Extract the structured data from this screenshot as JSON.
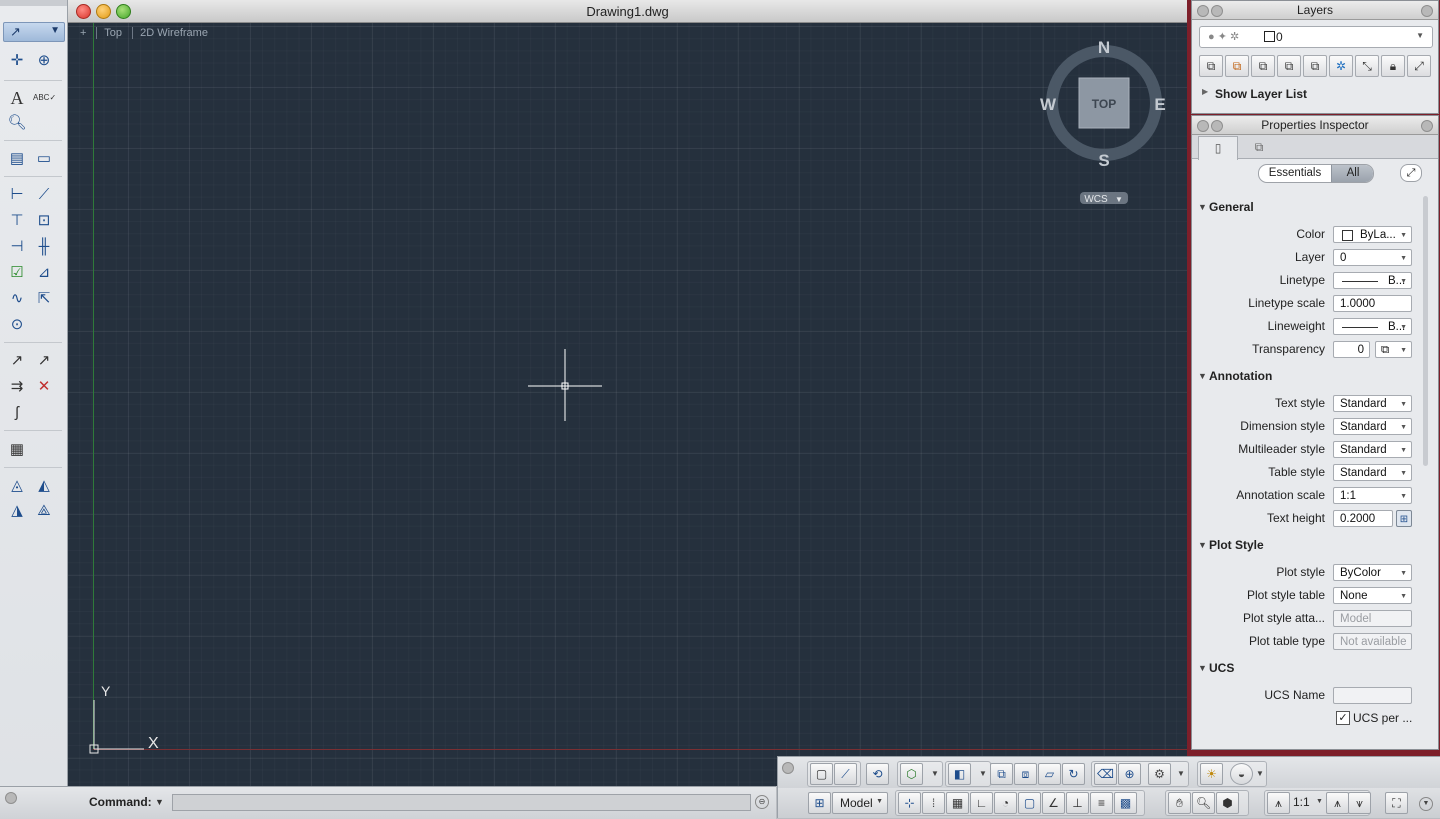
{
  "drawing": {
    "title": "Drawing1.dwg",
    "view_controls": [
      "+",
      "Top",
      "2D Wireframe"
    ],
    "viewcube": {
      "north": "N",
      "south": "S",
      "east": "E",
      "west": "W",
      "face": "TOP",
      "ucs_menu": "WCS"
    },
    "ucs_icon": {
      "x_label": "X",
      "y_label": "Y"
    }
  },
  "layers": {
    "title": "Layers",
    "current_layer": "0",
    "show_layer_list": "Show Layer List"
  },
  "properties": {
    "title": "Properties Inspector",
    "tabs": {
      "essentials": "Essentials",
      "all": "All"
    },
    "general": {
      "heading": "General",
      "color_label": "Color",
      "color_value": "ByLa...",
      "layer_label": "Layer",
      "layer_value": "0",
      "linetype_label": "Linetype",
      "linetype_value": "B...",
      "linetype_scale_label": "Linetype scale",
      "linetype_scale_value": "1.0000",
      "lineweight_label": "Lineweight",
      "lineweight_value": "B...",
      "transparency_label": "Transparency",
      "transparency_value": "0"
    },
    "annotation": {
      "heading": "Annotation",
      "text_style_label": "Text style",
      "text_style_value": "Standard",
      "dimension_style_label": "Dimension style",
      "dimension_style_value": "Standard",
      "multileader_style_label": "Multileader style",
      "multileader_style_value": "Standard",
      "table_style_label": "Table style",
      "table_style_value": "Standard",
      "annotation_scale_label": "Annotation scale",
      "annotation_scale_value": "1:1",
      "text_height_label": "Text height",
      "text_height_value": "0.2000"
    },
    "plot_style": {
      "heading": "Plot Style",
      "plot_style_label": "Plot style",
      "plot_style_value": "ByColor",
      "plot_style_table_label": "Plot style table",
      "plot_style_table_value": "None",
      "plot_style_attached_label": "Plot style atta...",
      "plot_style_attached_value": "Model",
      "plot_table_type_label": "Plot table type",
      "plot_table_type_value": "Not available"
    },
    "ucs": {
      "heading": "UCS",
      "ucs_name_label": "UCS Name",
      "ucs_name_value": "",
      "ucs_per_viewport_label": "UCS per ..."
    }
  },
  "command": {
    "label": "Command:",
    "value": ""
  },
  "status": {
    "model_label": "Model",
    "annotation_scale": "1:1"
  },
  "colors": {
    "canvas": "#25303d",
    "accent": "#1e4d8c",
    "crosshair": "#ffffff"
  }
}
